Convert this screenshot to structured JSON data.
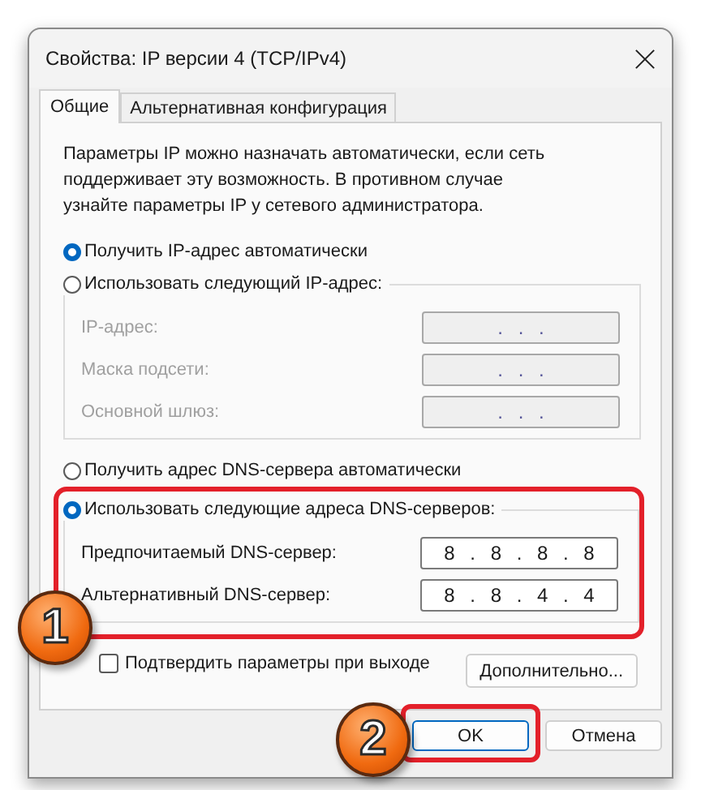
{
  "window": {
    "title": "Свойства: IP версии 4 (TCP/IPv4)"
  },
  "tabs": [
    {
      "label": "Общие",
      "selected": true
    },
    {
      "label": "Альтернативная конфигурация",
      "selected": false
    }
  ],
  "description": "Параметры IP можно назначать автоматически, если сеть поддерживает эту возможность. В противном случае узнайте параметры IP у сетевого администратора.",
  "ip_section": {
    "auto_option": {
      "label": "Получить IP-адрес автоматически",
      "selected": true
    },
    "manual_option": {
      "label": "Использовать следующий IP-адрес:",
      "selected": false
    },
    "fields": [
      {
        "label": "IP-адрес:",
        "value": ". . .",
        "disabled": true
      },
      {
        "label": "Маска подсети:",
        "value": ". . .",
        "disabled": true
      },
      {
        "label": "Основной шлюз:",
        "value": ". . .",
        "disabled": true
      }
    ]
  },
  "dns_section": {
    "auto_option": {
      "label": "Получить адрес DNS-сервера автоматически",
      "selected": false
    },
    "manual_option": {
      "label": "Использовать следующие адреса DNS-серверов:",
      "selected": true
    },
    "fields": [
      {
        "label": "Предпочитаемый DNS-сервер:",
        "value": "8 . 8 . 8 . 8",
        "disabled": false
      },
      {
        "label": "Альтернативный DNS-сервер:",
        "value": "8 . 8 . 4 . 4",
        "disabled": false
      }
    ]
  },
  "confirm_checkbox": {
    "label": "Подтвердить параметры при выходе",
    "checked": false
  },
  "advanced_button": {
    "label": "Дополнительно..."
  },
  "buttons": [
    {
      "label": "OK",
      "default": true
    },
    {
      "label": "Отмена",
      "default": false
    }
  ],
  "callouts": [
    {
      "number": "1"
    },
    {
      "number": "2"
    }
  ]
}
